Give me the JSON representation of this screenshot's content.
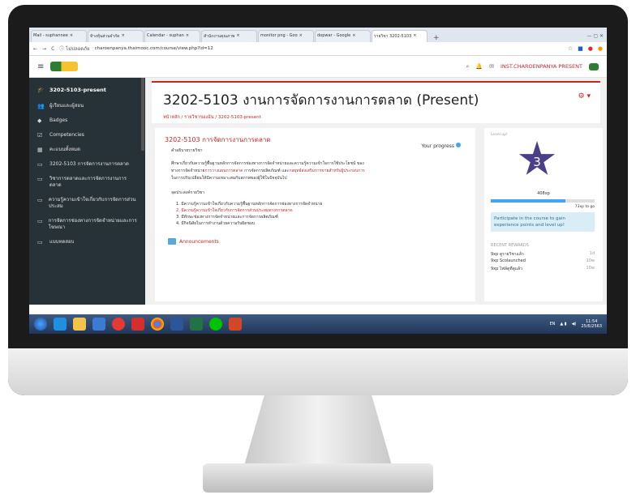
{
  "browser": {
    "tabs": [
      {
        "label": "Mail - suphannee",
        "close": "×"
      },
      {
        "label": "ห้างหุ้นส่วนจำกัด",
        "close": "×"
      },
      {
        "label": "Calendar - suphan",
        "close": "×"
      },
      {
        "label": "สำนักงานคุณภาพ",
        "close": "×"
      },
      {
        "label": "monitor png - Goo",
        "close": "×"
      },
      {
        "label": "dopwar - Google",
        "close": "×"
      },
      {
        "label": "รายวิชา 3202-5103",
        "close": "×"
      }
    ],
    "new_tab": "+",
    "window_controls": "— ▢ ✕",
    "nav_back": "←",
    "nav_forward": "→",
    "nav_reload": "C",
    "secure": "ⓘ ไม่ปลอดภัย",
    "url": "charoenpanya.thaimooc.com/course/view.php?id=12"
  },
  "header": {
    "menu_icon": "≡",
    "search_icon": "⌕",
    "bell_icon": "🔔",
    "chat_icon": "✉",
    "username": "INST.CHAROENPANYA PRESENT"
  },
  "drawer": {
    "course": "3202-5103-present",
    "items": [
      {
        "icon": "👥",
        "label": "ผู้เรียนและผู้สอน"
      },
      {
        "icon": "◆",
        "label": "Badges"
      },
      {
        "icon": "☑",
        "label": "Competencies"
      },
      {
        "icon": "▦",
        "label": "คะแนนทั้งหมด"
      },
      {
        "icon": "▭",
        "label": "3202-5103 การจัดการงานการตลาด"
      },
      {
        "icon": "▭",
        "label": "วิชาการตลาดและการจัดการงานการตลาด"
      },
      {
        "icon": "▭",
        "label": "ความรู้ความเข้าใจเกี่ยวกับการจัดการส่วนประสม"
      },
      {
        "icon": "▭",
        "label": "การจัดการช่องทางการจัดจำหน่ายและการโฆษณา"
      },
      {
        "icon": "▭",
        "label": "แบบทดสอบ"
      }
    ]
  },
  "page": {
    "title": "3202-5103 งานการจัดการงานการตลาด (Present)",
    "breadcrumb": "หน้าหลัก / รายวิชาของฉัน / 3202-5103-present",
    "settings_icon": "⚙ ▾"
  },
  "course_card": {
    "title": "3202-5103 การจัดการงานการตลาด",
    "subtitle": "คำอธิบายรายวิชา",
    "progress_label": "Your progress",
    "desc_1": "ศึกษาเกี่ยวกับความรู้พื้นฐานหลักการจัดการช่องทางการจัดจำหน่ายและความรู้ความเข้าใจการใช้ประโยชน์ ของ",
    "desc_2a": "ทางการจัดจำหน่าย",
    "desc_2b": "การวางแผนการตลาด",
    "desc_2c": " การจัดการผลิตภัณฑ์ และ",
    "desc_2d": "กลยุทธ์ส่งเสริมการขายสำหรับผู้ประกอบการ",
    "desc_3": "ในการปรับเปลี่ยนให้มีความเหมาะสมกับสภาพของผู้ใช้ในปัจจุบันไป",
    "objectives_title": "จุดประสงค์รายวิชา",
    "objectives": [
      "1.  มีความรู้ความเข้าใจเกี่ยวกับความรู้พื้นฐานหลักการจัดการช่องทางการจัดจำหน่าย",
      "2.  มีความรู้ความเข้าใจเกี่ยวกับการจัดการส่วนประสมทางการตลาด",
      "3.  มีทักษะช่องทางการจัดจำหน่ายและการจัดการผลิตภัณฑ์",
      "4.  มีกิจนิสัยในการทำงานด้วยความรับผิดชอบ"
    ],
    "announcements": "Announcements"
  },
  "level_block": {
    "heading": "Level up!",
    "level": "3",
    "xp": "408xp",
    "xp_next": "73xp to go",
    "progress": 0.72,
    "info": "Participate in the course to gain experience points and level up!",
    "recent_title": "RECENT REWARDS",
    "rewards": [
      {
        "xp": "9xp",
        "label": "ดูรายวิชาแล้ว",
        "time": "1d"
      },
      {
        "xp": "9xp",
        "label": "Scolaunched",
        "time": "10w"
      },
      {
        "xp": "9xp",
        "label": "ไฟล์ดูที่ดูแล้ว",
        "time": "10w"
      }
    ]
  },
  "taskbar": {
    "lang": "EN",
    "time": "11:54",
    "date": "25/6/2563"
  },
  "colors": {
    "accent": "#c62828",
    "drawer": "#263238",
    "level_star": "#4b3f8a",
    "taskbar": "#2b4470"
  }
}
